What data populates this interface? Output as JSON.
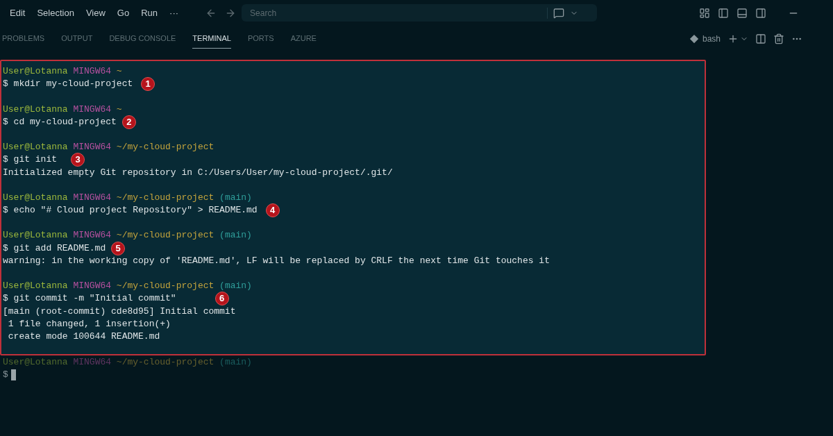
{
  "menu_bar": {
    "items": [
      "Edit",
      "Selection",
      "View",
      "Go",
      "Run",
      "···"
    ],
    "search": {
      "placeholder": "Search"
    }
  },
  "panel_tabs": [
    {
      "label": "PROBLEMS",
      "selected": false
    },
    {
      "label": "OUTPUT",
      "selected": false
    },
    {
      "label": "DEBUG CONSOLE",
      "selected": false
    },
    {
      "label": "TERMINAL",
      "selected": true
    },
    {
      "label": "PORTS",
      "selected": false
    },
    {
      "label": "AZURE",
      "selected": false
    }
  ],
  "terminal_profile": "bash",
  "terminal": {
    "highlighted_blocks": [
      {
        "prompt": {
          "user": "User@Lotanna",
          "host": "MINGW64",
          "path": "~"
        },
        "command": "$ mkdir my-cloud-project",
        "step": "1"
      },
      {
        "prompt": {
          "user": "User@Lotanna",
          "host": "MINGW64",
          "path": "~"
        },
        "command": "$ cd my-cloud-project",
        "step": "2"
      },
      {
        "prompt": {
          "user": "User@Lotanna",
          "host": "MINGW64",
          "path": "~/my-cloud-project"
        },
        "command": "$ git init",
        "step": "3",
        "output": [
          "Initialized empty Git repository in C:/Users/User/my-cloud-project/.git/"
        ]
      },
      {
        "prompt": {
          "user": "User@Lotanna",
          "host": "MINGW64",
          "path": "~/my-cloud-project",
          "branch": "(main)"
        },
        "command": "$ echo \"# Cloud project Repository\" > README.md",
        "step": "4"
      },
      {
        "prompt": {
          "user": "User@Lotanna",
          "host": "MINGW64",
          "path": "~/my-cloud-project",
          "branch": "(main)"
        },
        "command": "$ git add README.md",
        "step": "5",
        "output": [
          "warning: in the working copy of 'README.md', LF will be replaced by CRLF the next time Git touches it"
        ]
      },
      {
        "prompt": {
          "user": "User@Lotanna",
          "host": "MINGW64",
          "path": "~/my-cloud-project",
          "branch": "(main)"
        },
        "command": "$ git commit -m \"Initial commit\"",
        "step": "6",
        "output": [
          "[main (root-commit) cde8d95] Initial commit",
          " 1 file changed, 1 insertion(+)",
          " create mode 100644 README.md"
        ]
      }
    ],
    "current_prompt": {
      "user": "User@Lotanna",
      "host": "MINGW64",
      "path": "~/my-cloud-project",
      "branch": "(main)"
    },
    "current_input": "$"
  }
}
